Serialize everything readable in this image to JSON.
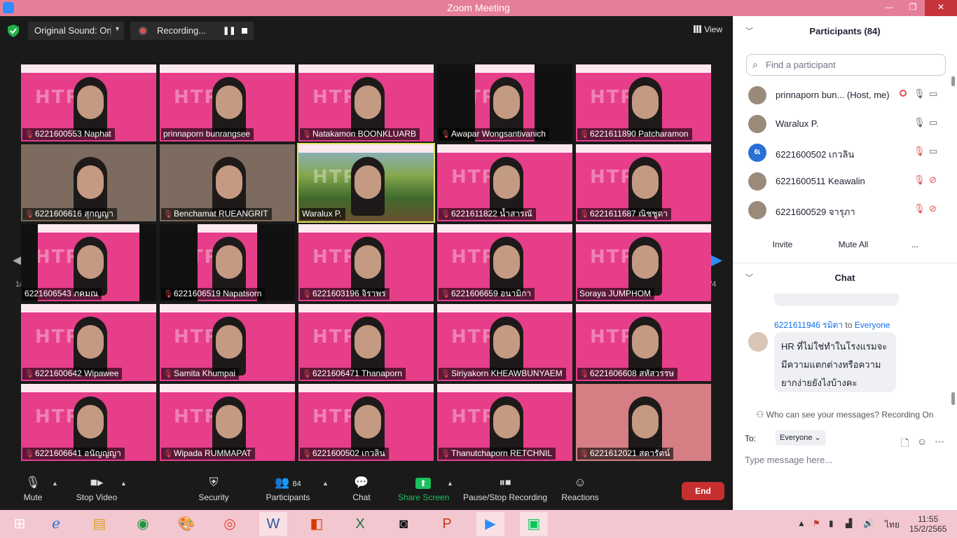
{
  "window": {
    "title": "Zoom Meeting",
    "controls": {
      "minimize": "—",
      "maximize": "❐",
      "close": "✕"
    }
  },
  "topbar": {
    "sound_label": "Original Sound: On",
    "recording_label": "Recording...",
    "view_label": "View",
    "pause_glyph": "❚❚"
  },
  "gallery": {
    "page_left": "1/4",
    "page_right": "1/4",
    "arrow_left": "◀",
    "arrow_right": "▶",
    "tiles": [
      {
        "name": "6221600553 Naphat",
        "muted": true,
        "style": "pink"
      },
      {
        "name": "prinnaporn bunrangsee",
        "muted": false,
        "style": "pink"
      },
      {
        "name": "Natakamon BOONKLUARB",
        "muted": true,
        "style": "pink"
      },
      {
        "name": "Awapar Wongsantivanich",
        "muted": true,
        "style": "wide-black"
      },
      {
        "name": "6221611890 Patcharamon",
        "muted": true,
        "style": "pink"
      },
      {
        "name": "6221606616 สุกญญา",
        "muted": true,
        "style": "room"
      },
      {
        "name": "Benchamat RUEANGRIT",
        "muted": true,
        "style": "room"
      },
      {
        "name": "Waralux P.",
        "muted": false,
        "style": "active"
      },
      {
        "name": "6221611822 น้ำสารณั",
        "muted": true,
        "style": "pink"
      },
      {
        "name": "6221611687 ณิชชูดา",
        "muted": true,
        "style": "pink"
      },
      {
        "name": "6221606543 ภคมณ",
        "muted": false,
        "style": "black-sides"
      },
      {
        "name": "6221606519 Napatsorn",
        "muted": true,
        "style": "wide-black"
      },
      {
        "name": "6221603196 จิราพร",
        "muted": true,
        "style": "pink"
      },
      {
        "name": "6221606659 อนามิกา",
        "muted": true,
        "style": "pink"
      },
      {
        "name": "Soraya JUMPHOM",
        "muted": false,
        "style": "pink"
      },
      {
        "name": "6221600642 Wipawee",
        "muted": true,
        "style": "pink"
      },
      {
        "name": "Samita Khumpai",
        "muted": true,
        "style": "pink"
      },
      {
        "name": "6221606471 Thanaporn",
        "muted": true,
        "style": "pink"
      },
      {
        "name": "Siriyakorn KHEAWBUNYAEM",
        "muted": true,
        "style": "pink"
      },
      {
        "name": "6221606608 สหัสวรรษ",
        "muted": true,
        "style": "pink"
      },
      {
        "name": "6221606641 อนัญญญา",
        "muted": true,
        "style": "pink"
      },
      {
        "name": "Wipada RUMMAPAT",
        "muted": true,
        "style": "pink"
      },
      {
        "name": "6221600502 เกวลิน",
        "muted": true,
        "style": "pink"
      },
      {
        "name": "Thanutchaporn RETCHNIL",
        "muted": true,
        "style": "pink"
      },
      {
        "name": "6221612021 สดารัตน์",
        "muted": true,
        "style": "wall"
      }
    ]
  },
  "toolbar": {
    "mute": "Mute",
    "stop_video": "Stop Video",
    "security": "Security",
    "participants": "Participants",
    "participants_count": "84",
    "chat": "Chat",
    "share_screen": "Share Screen",
    "pause_stop_recording": "Pause/Stop Recording",
    "reactions": "Reactions",
    "end": "End"
  },
  "participants_panel": {
    "title": "Participants (84)",
    "search_placeholder": "Find a participant",
    "list": [
      {
        "name": "prinnaporn bun...",
        "tag": "(Host, me)",
        "mic_muted": false,
        "cam_off": false
      },
      {
        "name": "Waralux P.",
        "tag": "",
        "mic_muted": false,
        "cam_off": false
      },
      {
        "name": "6221600502 เกวลิน",
        "tag": "",
        "mic_muted": true,
        "cam_off": false,
        "avatar_text": "6เ"
      },
      {
        "name": "6221600511 Keawalin",
        "tag": "",
        "mic_muted": true,
        "cam_off": true
      },
      {
        "name": "6221600529 จารุภา",
        "tag": "",
        "mic_muted": true,
        "cam_off": true
      }
    ],
    "invite": "Invite",
    "mute_all": "Mute All",
    "more": "..."
  },
  "chat_panel": {
    "title": "Chat",
    "sender": "6221611946 รมิตา",
    "to": "to",
    "recipient": "Everyone",
    "message": "HR ที่ไม่ใช่ทำในโรงแรมจะมีความแตกต่างหรือความยากง่ายยังไงบ้างคะ",
    "who_can_see": "Who can see your messages? Recording On",
    "to_label": "To:",
    "to_value": "Everyone",
    "input_placeholder": "Type message here..."
  },
  "taskbar": {
    "language": "ไทย",
    "time": "11:55",
    "date": "15/2/2565"
  },
  "colors": {
    "zoom_blue": "#2d8cff",
    "tile_pink": "#e73e8a",
    "muted_red": "#e04e4e",
    "share_green": "#1dbf5c",
    "end_red": "#c72f2f",
    "titlebar_pink": "#e57f98"
  }
}
